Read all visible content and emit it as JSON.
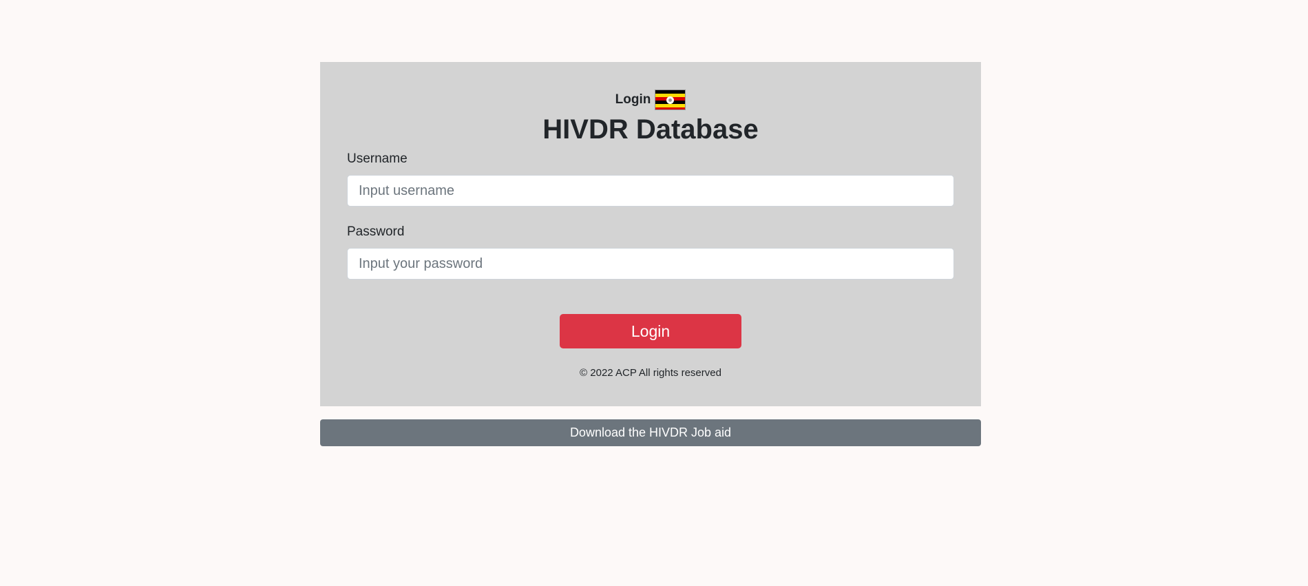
{
  "header": {
    "login_caption": "Login",
    "flag_icon": "uganda-flag-icon",
    "app_title": "HIVDR Database"
  },
  "form": {
    "username_label": "Username",
    "username_placeholder": "Input username",
    "username_value": "",
    "password_label": "Password",
    "password_placeholder": "Input your password",
    "password_value": "",
    "login_button_label": "Login"
  },
  "footer": {
    "copyright": "© 2022 ACP All rights reserved",
    "download_link_label": "Download the HIVDR Job aid"
  },
  "colors": {
    "page_background": "#fdf9f8",
    "card_background": "#d3d3d3",
    "primary_button": "#dc3545",
    "secondary_button": "#6c757d",
    "flag_black": "#000000",
    "flag_yellow": "#fcdc04",
    "flag_red": "#d90000"
  }
}
